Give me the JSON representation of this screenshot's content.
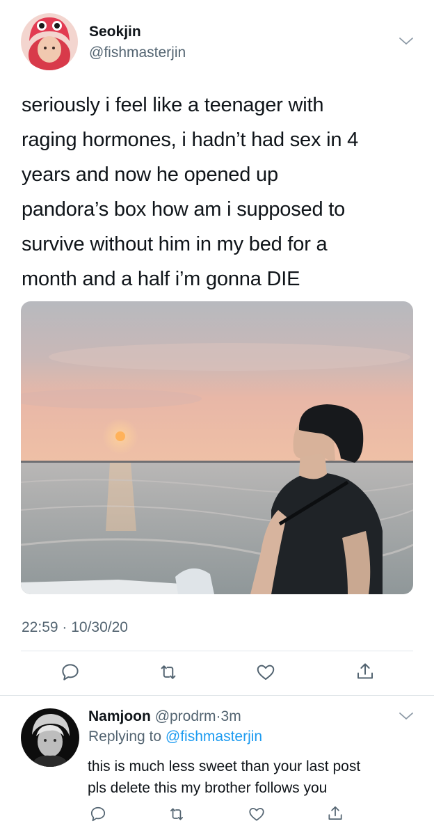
{
  "main_tweet": {
    "author": {
      "display_name": "Seokjin",
      "handle": "@fishmasterjin",
      "avatar": "avatar-photo-red-hat"
    },
    "text_lines": [
      "seriously i feel like a teenager with",
      "raging hormones, i hadn’t had sex in 4",
      "years and now he opened up",
      "pandora’s box how am i supposed to",
      "survive without him in my bed for a",
      "month and a half i’m gonna DIE"
    ],
    "media": "sunset-boat-photo",
    "timestamp": "22:59 · 10/30/20",
    "actions": [
      "reply-icon",
      "retweet-icon",
      "like-icon",
      "share-icon"
    ]
  },
  "reply_tweet": {
    "author": {
      "display_name": "Namjoon",
      "handle": "@prodrm",
      "separator": "·",
      "time": "3m",
      "avatar": "avatar-photo-bw"
    },
    "replying_prefix": "Replying to ",
    "replying_to": "@fishmasterjin",
    "text_lines": [
      "this is much less sweet than your last post",
      "pls delete this my brother follows you"
    ],
    "actions": [
      "reply-icon",
      "retweet-icon",
      "like-icon",
      "share-icon"
    ]
  },
  "colors": {
    "primary_text": "#0f1419",
    "secondary_text": "#536471",
    "link": "#1d9bf0",
    "divider": "#e1e6ea"
  }
}
